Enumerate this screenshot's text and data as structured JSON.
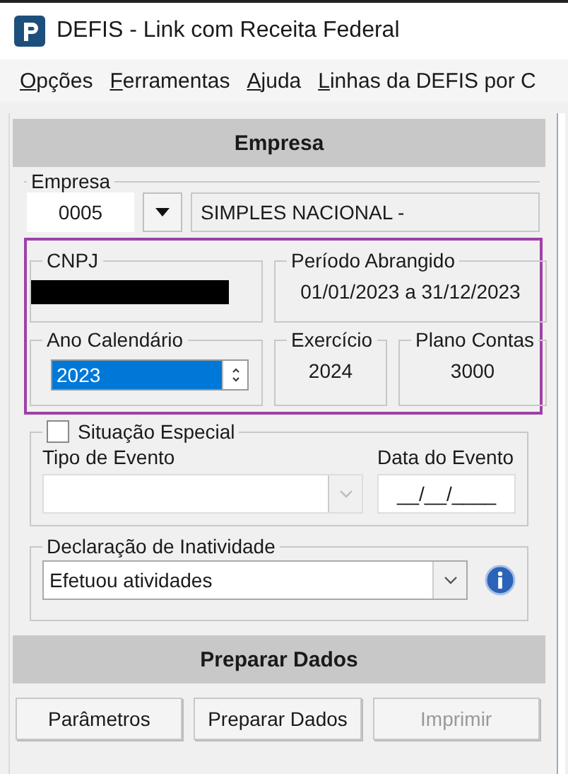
{
  "window": {
    "title": "DEFIS - Link com Receita Federal"
  },
  "menu": [
    {
      "label": "Opções"
    },
    {
      "label": "Ferramentas"
    },
    {
      "label": "Ajuda"
    },
    {
      "label": "Linhas da DEFIS por C"
    }
  ],
  "empresa_section": {
    "header": "Empresa",
    "group_label": "Empresa",
    "code": "0005",
    "name": "SIMPLES NACIONAL -"
  },
  "highlight": {
    "on": true
  },
  "cnpj": {
    "label": "CNPJ",
    "redacted": true
  },
  "periodo": {
    "label": "Período Abrangido",
    "value": "01/01/2023 a 31/12/2023"
  },
  "ano_calendario": {
    "label": "Ano Calendário",
    "value": "2023",
    "selected": true
  },
  "exercicio": {
    "label": "Exercício",
    "value": "2024"
  },
  "plano_contas": {
    "label": "Plano Contas",
    "value": "3000"
  },
  "situacao_especial": {
    "label": "Situação Especial",
    "checked": false,
    "tipo_label": "Tipo de Evento",
    "tipo_disabled": true,
    "data_label": "Data do Evento",
    "data_value": "__/__/____"
  },
  "declaracao": {
    "label": "Declaração de Inatividade",
    "value": "Efetuou atividades"
  },
  "preparar_section": {
    "header": "Preparar Dados"
  },
  "buttons": [
    {
      "label": "Parâmetros",
      "disabled": false
    },
    {
      "label": "Preparar Dados",
      "disabled": false
    },
    {
      "label": "Imprimir",
      "disabled": true
    }
  ]
}
